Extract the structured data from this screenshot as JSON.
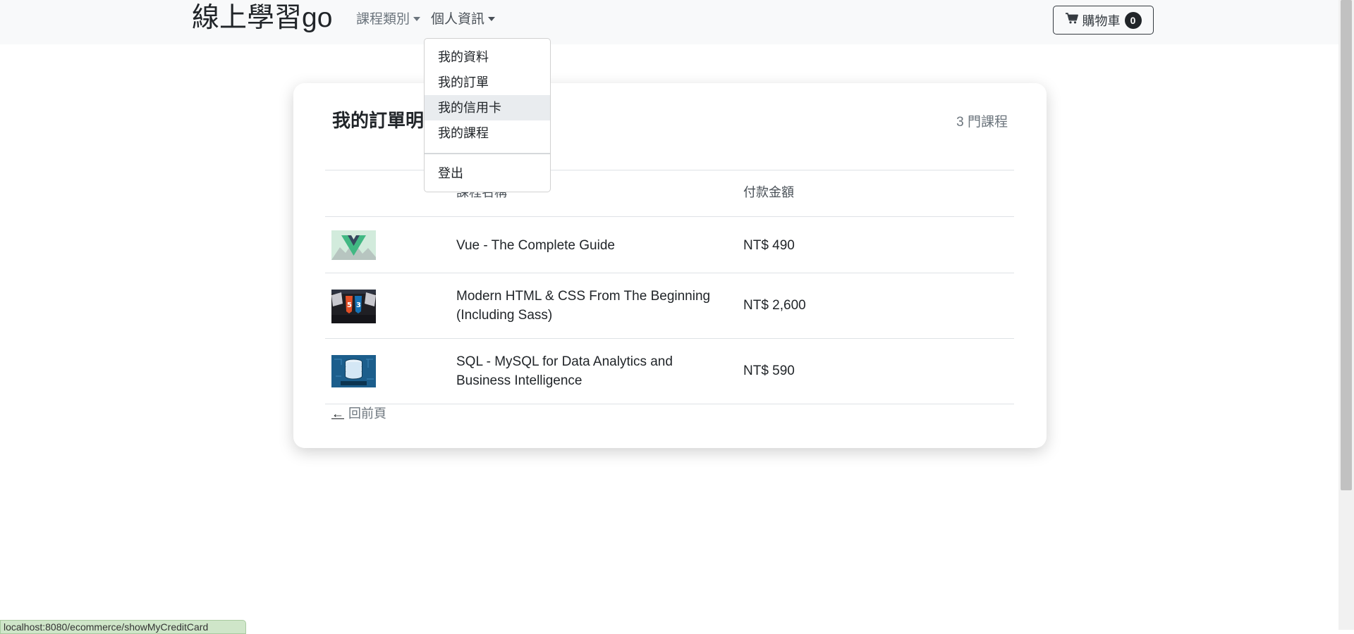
{
  "navbar": {
    "brand": "線上學習go",
    "menu": [
      {
        "label": "課程類別"
      },
      {
        "label": "個人資訊"
      }
    ],
    "cart": {
      "label": "購物車",
      "count": "0",
      "icon": "shopping-cart-icon"
    }
  },
  "dropdown": {
    "items": [
      {
        "label": "我的資料"
      },
      {
        "label": "我的訂單"
      },
      {
        "label": "我的信用卡"
      },
      {
        "label": "我的課程"
      }
    ],
    "logout": "登出",
    "hovered_item": "我的信用卡"
  },
  "card": {
    "title": "我的訂單明",
    "count": "3 門課程",
    "columns": [
      "",
      "課程名稱",
      "付款金額"
    ],
    "rows": [
      {
        "thumb": "vue-logo-thumbnail",
        "name": "Vue - The Complete Guide",
        "price": "NT$ 490"
      },
      {
        "thumb": "html-css-thumbnail",
        "name": "Modern HTML & CSS From The Beginning (Including Sass)",
        "price": "NT$ 2,600"
      },
      {
        "thumb": "database-thumbnail",
        "name": "SQL - MySQL for Data Analytics and Business Intelligence",
        "price": "NT$ 590"
      }
    ],
    "back": {
      "arrow": "←",
      "label": "回前頁"
    }
  },
  "status_bar": {
    "url": "localhost:8080/ecommerce/showMyCreditCard"
  },
  "colors": {
    "navbar_bg": "#f8f9fa",
    "muted": "#6c757d",
    "hover_bg": "#e9ecef"
  }
}
